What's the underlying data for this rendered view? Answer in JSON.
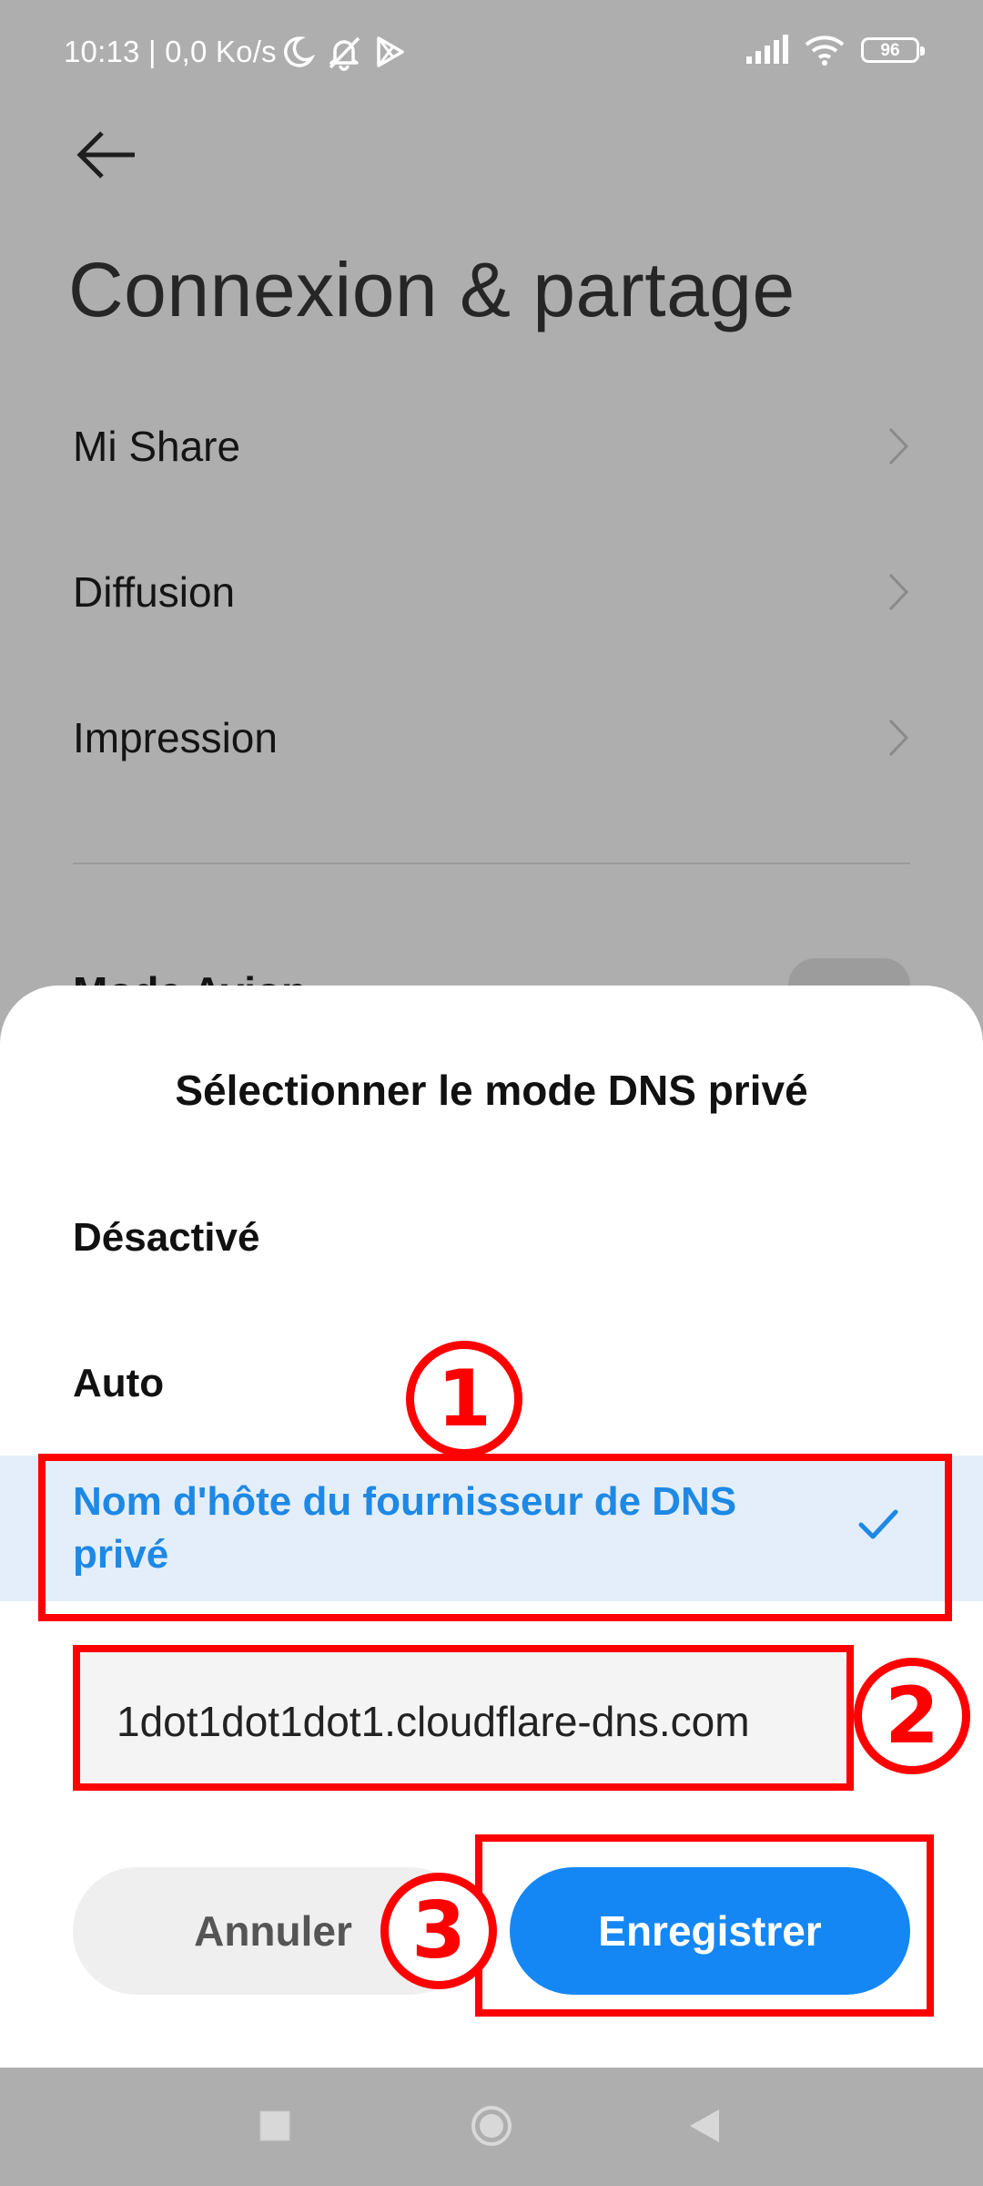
{
  "status_bar": {
    "time_speed": "10:13 | 0,0 Ko/s",
    "battery_level": "96",
    "icons_left": [
      "moon-icon",
      "bell-off-icon",
      "play-store-icon"
    ],
    "icons_right": [
      "signal-icon",
      "wifi-icon",
      "battery-icon"
    ]
  },
  "page": {
    "title": "Connexion & partage",
    "items": [
      {
        "label": "Mi Share"
      },
      {
        "label": "Diffusion"
      },
      {
        "label": "Impression"
      }
    ],
    "partial_item": "Mode Avion"
  },
  "dialog": {
    "title": "Sélectionner le mode DNS privé",
    "options": [
      {
        "label": "Désactivé",
        "selected": false
      },
      {
        "label": "Auto",
        "selected": false
      },
      {
        "label": "Nom d'hôte du fournisseur de DNS privé",
        "selected": true
      }
    ],
    "hostname_value": "1dot1dot1dot1.cloudflare-dns.com",
    "cancel_label": "Annuler",
    "save_label": "Enregistrer"
  },
  "annotations": {
    "step1": "1",
    "step2": "2",
    "step3": "3"
  },
  "colors": {
    "accent": "#1587f5",
    "selected_bg": "#e3eefa",
    "annotation": "#ff0000",
    "scrim": "#aeaeae"
  }
}
